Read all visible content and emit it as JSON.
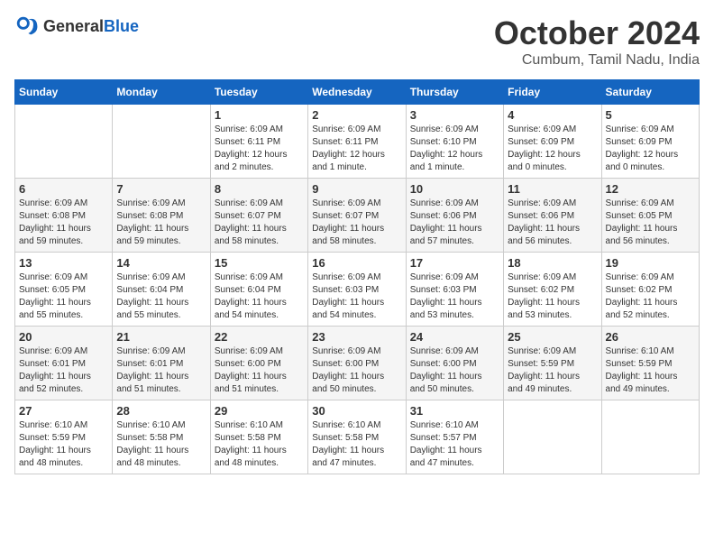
{
  "logo": {
    "text_general": "General",
    "text_blue": "Blue"
  },
  "header": {
    "month": "October 2024",
    "location": "Cumbum, Tamil Nadu, India"
  },
  "weekdays": [
    "Sunday",
    "Monday",
    "Tuesday",
    "Wednesday",
    "Thursday",
    "Friday",
    "Saturday"
  ],
  "weeks": [
    [
      {
        "day": "",
        "info": ""
      },
      {
        "day": "",
        "info": ""
      },
      {
        "day": "1",
        "info": "Sunrise: 6:09 AM\nSunset: 6:11 PM\nDaylight: 12 hours\nand 2 minutes."
      },
      {
        "day": "2",
        "info": "Sunrise: 6:09 AM\nSunset: 6:11 PM\nDaylight: 12 hours\nand 1 minute."
      },
      {
        "day": "3",
        "info": "Sunrise: 6:09 AM\nSunset: 6:10 PM\nDaylight: 12 hours\nand 1 minute."
      },
      {
        "day": "4",
        "info": "Sunrise: 6:09 AM\nSunset: 6:09 PM\nDaylight: 12 hours\nand 0 minutes."
      },
      {
        "day": "5",
        "info": "Sunrise: 6:09 AM\nSunset: 6:09 PM\nDaylight: 12 hours\nand 0 minutes."
      }
    ],
    [
      {
        "day": "6",
        "info": "Sunrise: 6:09 AM\nSunset: 6:08 PM\nDaylight: 11 hours\nand 59 minutes."
      },
      {
        "day": "7",
        "info": "Sunrise: 6:09 AM\nSunset: 6:08 PM\nDaylight: 11 hours\nand 59 minutes."
      },
      {
        "day": "8",
        "info": "Sunrise: 6:09 AM\nSunset: 6:07 PM\nDaylight: 11 hours\nand 58 minutes."
      },
      {
        "day": "9",
        "info": "Sunrise: 6:09 AM\nSunset: 6:07 PM\nDaylight: 11 hours\nand 58 minutes."
      },
      {
        "day": "10",
        "info": "Sunrise: 6:09 AM\nSunset: 6:06 PM\nDaylight: 11 hours\nand 57 minutes."
      },
      {
        "day": "11",
        "info": "Sunrise: 6:09 AM\nSunset: 6:06 PM\nDaylight: 11 hours\nand 56 minutes."
      },
      {
        "day": "12",
        "info": "Sunrise: 6:09 AM\nSunset: 6:05 PM\nDaylight: 11 hours\nand 56 minutes."
      }
    ],
    [
      {
        "day": "13",
        "info": "Sunrise: 6:09 AM\nSunset: 6:05 PM\nDaylight: 11 hours\nand 55 minutes."
      },
      {
        "day": "14",
        "info": "Sunrise: 6:09 AM\nSunset: 6:04 PM\nDaylight: 11 hours\nand 55 minutes."
      },
      {
        "day": "15",
        "info": "Sunrise: 6:09 AM\nSunset: 6:04 PM\nDaylight: 11 hours\nand 54 minutes."
      },
      {
        "day": "16",
        "info": "Sunrise: 6:09 AM\nSunset: 6:03 PM\nDaylight: 11 hours\nand 54 minutes."
      },
      {
        "day": "17",
        "info": "Sunrise: 6:09 AM\nSunset: 6:03 PM\nDaylight: 11 hours\nand 53 minutes."
      },
      {
        "day": "18",
        "info": "Sunrise: 6:09 AM\nSunset: 6:02 PM\nDaylight: 11 hours\nand 53 minutes."
      },
      {
        "day": "19",
        "info": "Sunrise: 6:09 AM\nSunset: 6:02 PM\nDaylight: 11 hours\nand 52 minutes."
      }
    ],
    [
      {
        "day": "20",
        "info": "Sunrise: 6:09 AM\nSunset: 6:01 PM\nDaylight: 11 hours\nand 52 minutes."
      },
      {
        "day": "21",
        "info": "Sunrise: 6:09 AM\nSunset: 6:01 PM\nDaylight: 11 hours\nand 51 minutes."
      },
      {
        "day": "22",
        "info": "Sunrise: 6:09 AM\nSunset: 6:00 PM\nDaylight: 11 hours\nand 51 minutes."
      },
      {
        "day": "23",
        "info": "Sunrise: 6:09 AM\nSunset: 6:00 PM\nDaylight: 11 hours\nand 50 minutes."
      },
      {
        "day": "24",
        "info": "Sunrise: 6:09 AM\nSunset: 6:00 PM\nDaylight: 11 hours\nand 50 minutes."
      },
      {
        "day": "25",
        "info": "Sunrise: 6:09 AM\nSunset: 5:59 PM\nDaylight: 11 hours\nand 49 minutes."
      },
      {
        "day": "26",
        "info": "Sunrise: 6:10 AM\nSunset: 5:59 PM\nDaylight: 11 hours\nand 49 minutes."
      }
    ],
    [
      {
        "day": "27",
        "info": "Sunrise: 6:10 AM\nSunset: 5:59 PM\nDaylight: 11 hours\nand 48 minutes."
      },
      {
        "day": "28",
        "info": "Sunrise: 6:10 AM\nSunset: 5:58 PM\nDaylight: 11 hours\nand 48 minutes."
      },
      {
        "day": "29",
        "info": "Sunrise: 6:10 AM\nSunset: 5:58 PM\nDaylight: 11 hours\nand 48 minutes."
      },
      {
        "day": "30",
        "info": "Sunrise: 6:10 AM\nSunset: 5:58 PM\nDaylight: 11 hours\nand 47 minutes."
      },
      {
        "day": "31",
        "info": "Sunrise: 6:10 AM\nSunset: 5:57 PM\nDaylight: 11 hours\nand 47 minutes."
      },
      {
        "day": "",
        "info": ""
      },
      {
        "day": "",
        "info": ""
      }
    ]
  ]
}
